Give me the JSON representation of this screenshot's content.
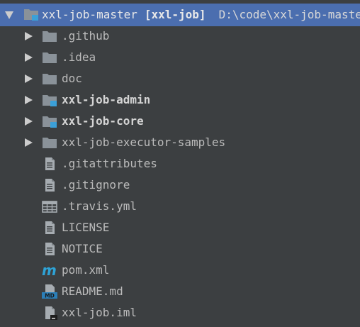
{
  "tree": {
    "root": {
      "name": "xxl-job-master",
      "module": "[xxl-job]",
      "path": "D:\\code\\xxl-job-master",
      "icon": "module-folder-icon",
      "expanded": true
    },
    "children": [
      {
        "label": "github",
        "display": ".github",
        "icon": "folder-icon",
        "expandable": true
      },
      {
        "display": ".idea",
        "icon": "folder-icon",
        "expandable": true
      },
      {
        "display": "doc",
        "icon": "folder-icon",
        "expandable": true
      },
      {
        "display": "xxl-job-admin",
        "icon": "module-folder-icon",
        "expandable": true,
        "bold": true
      },
      {
        "display": "xxl-job-core",
        "icon": "module-folder-icon",
        "expandable": true,
        "bold": true
      },
      {
        "display": "xxl-job-executor-samples",
        "icon": "folder-icon",
        "expandable": true
      },
      {
        "display": ".gitattributes",
        "icon": "text-file-icon",
        "expandable": false
      },
      {
        "display": ".gitignore",
        "icon": "text-file-icon",
        "expandable": false
      },
      {
        "display": ".travis.yml",
        "icon": "yaml-file-icon",
        "expandable": false
      },
      {
        "display": "LICENSE",
        "icon": "text-file-icon",
        "expandable": false
      },
      {
        "display": "NOTICE",
        "icon": "text-file-icon",
        "expandable": false
      },
      {
        "display": "pom.xml",
        "icon": "maven-file-icon",
        "expandable": false
      },
      {
        "display": "README.md",
        "icon": "markdown-file-icon",
        "expandable": false,
        "badge": "MD"
      },
      {
        "display": "xxl-job.iml",
        "icon": "iml-file-icon",
        "expandable": false
      }
    ]
  },
  "colors": {
    "background": "#3c3f41",
    "selection": "#4b6eaf",
    "folder": "#8a9299",
    "module_marker": "#3ba0d8",
    "maven": "#2ea3d6"
  }
}
